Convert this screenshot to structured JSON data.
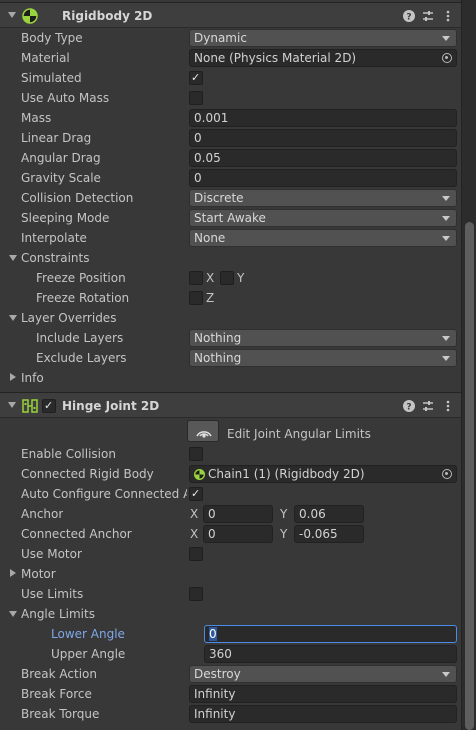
{
  "rigidbody": {
    "title": "Rigidbody 2D",
    "body_type": {
      "label": "Body Type",
      "value": "Dynamic"
    },
    "material": {
      "label": "Material",
      "value": "None (Physics Material 2D)"
    },
    "simulated": {
      "label": "Simulated",
      "checked": true
    },
    "use_auto_mass": {
      "label": "Use Auto Mass",
      "checked": false
    },
    "mass": {
      "label": "Mass",
      "value": "0.001"
    },
    "linear_drag": {
      "label": "Linear Drag",
      "value": "0"
    },
    "angular_drag": {
      "label": "Angular Drag",
      "value": "0.05"
    },
    "gravity_scale": {
      "label": "Gravity Scale",
      "value": "0"
    },
    "collision_detection": {
      "label": "Collision Detection",
      "value": "Discrete"
    },
    "sleeping_mode": {
      "label": "Sleeping Mode",
      "value": "Start Awake"
    },
    "interpolate": {
      "label": "Interpolate",
      "value": "None"
    },
    "constraints": {
      "label": "Constraints",
      "freeze_position": {
        "label": "Freeze Position",
        "x": "X",
        "y": "Y"
      },
      "freeze_rotation": {
        "label": "Freeze Rotation",
        "z": "Z"
      }
    },
    "layer_overrides": {
      "label": "Layer Overrides",
      "include_layers": {
        "label": "Include Layers",
        "value": "Nothing"
      },
      "exclude_layers": {
        "label": "Exclude Layers",
        "value": "Nothing"
      }
    },
    "info": {
      "label": "Info"
    }
  },
  "hinge": {
    "title": "Hinge Joint 2D",
    "edit_limits_label": "Edit Joint Angular Limits",
    "enable_collision": {
      "label": "Enable Collision",
      "checked": false
    },
    "connected_rigid_body": {
      "label": "Connected Rigid Body",
      "value": "Chain1 (1) (Rigidbody 2D)"
    },
    "auto_configure": {
      "label": "Auto Configure Connected An",
      "checked": true
    },
    "anchor": {
      "label": "Anchor",
      "x_label": "X",
      "x": "0",
      "y_label": "Y",
      "y": "0.06"
    },
    "connected_anchor": {
      "label": "Connected Anchor",
      "x_label": "X",
      "x": "0",
      "y_label": "Y",
      "y": "-0.065"
    },
    "use_motor": {
      "label": "Use Motor",
      "checked": false
    },
    "motor": {
      "label": "Motor"
    },
    "use_limits": {
      "label": "Use Limits",
      "checked": false
    },
    "angle_limits": {
      "label": "Angle Limits",
      "lower_angle": {
        "label": "Lower Angle",
        "value": "0"
      },
      "upper_angle": {
        "label": "Upper Angle",
        "value": "360"
      }
    },
    "break_action": {
      "label": "Break Action",
      "value": "Destroy"
    },
    "break_force": {
      "label": "Break Force",
      "value": "Infinity"
    },
    "break_torque": {
      "label": "Break Torque",
      "value": "Infinity"
    }
  },
  "colors": {
    "background": "#383838",
    "header": "#3e3e3e",
    "field": "#2a2a2a",
    "dropdown": "#515151",
    "active_label": "#7fa7e8",
    "focus_border": "#4a8be8"
  }
}
